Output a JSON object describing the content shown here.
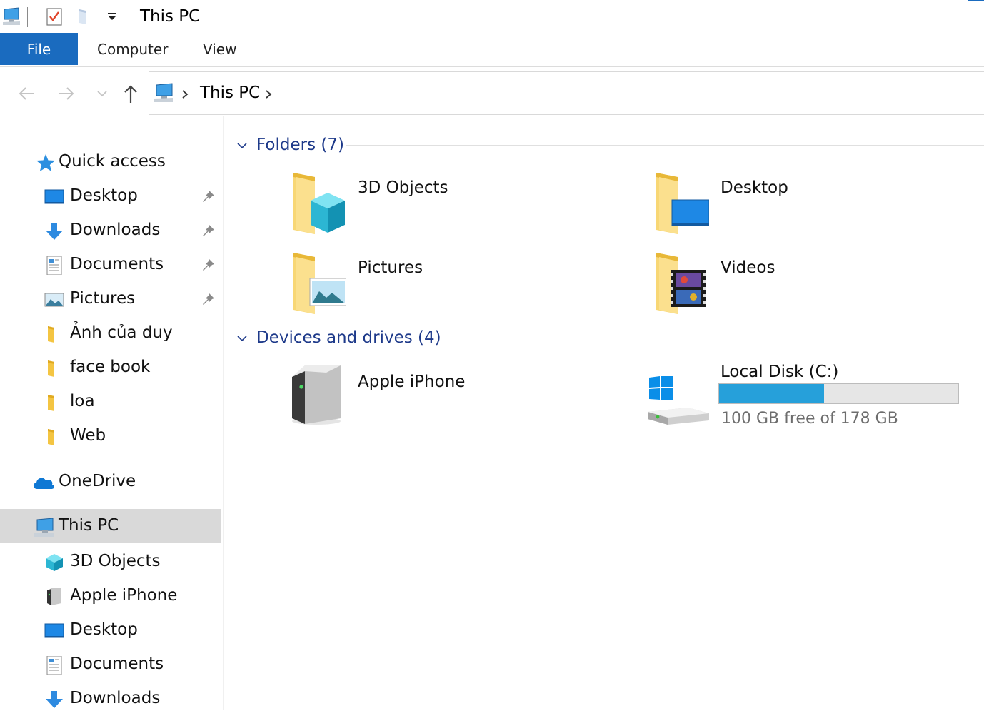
{
  "window": {
    "title": "This PC"
  },
  "ribbon": {
    "tabs": [
      "File",
      "Computer",
      "View"
    ]
  },
  "address": {
    "path": "This PC"
  },
  "sidebar": {
    "quick_access": {
      "label": "Quick access",
      "items": [
        {
          "label": "Desktop",
          "icon": "desktop-icon",
          "pinned": true
        },
        {
          "label": "Downloads",
          "icon": "downloads-icon",
          "pinned": true
        },
        {
          "label": "Documents",
          "icon": "documents-icon",
          "pinned": true
        },
        {
          "label": "Pictures",
          "icon": "pictures-icon",
          "pinned": true
        },
        {
          "label": "Ảnh của duy",
          "icon": "folder-icon",
          "pinned": false
        },
        {
          "label": "face book",
          "icon": "folder-icon",
          "pinned": false
        },
        {
          "label": "loa",
          "icon": "folder-icon",
          "pinned": false
        },
        {
          "label": "Web",
          "icon": "folder-icon",
          "pinned": false
        }
      ]
    },
    "onedrive": {
      "label": "OneDrive"
    },
    "this_pc": {
      "label": "This PC",
      "items": [
        {
          "label": "3D Objects",
          "icon": "cube-icon"
        },
        {
          "label": "Apple iPhone",
          "icon": "device-icon"
        },
        {
          "label": "Desktop",
          "icon": "desktop-icon"
        },
        {
          "label": "Documents",
          "icon": "documents-icon"
        },
        {
          "label": "Downloads",
          "icon": "downloads-icon"
        }
      ]
    }
  },
  "content": {
    "folders_header": "Folders (7)",
    "folders": [
      {
        "label": "3D Objects",
        "icon": "folder-3d-objects-icon"
      },
      {
        "label": "Desktop",
        "icon": "folder-desktop-icon"
      },
      {
        "label": "Pictures",
        "icon": "folder-pictures-icon"
      },
      {
        "label": "Videos",
        "icon": "folder-videos-icon"
      }
    ],
    "devices_header": "Devices and drives (4)",
    "devices": [
      {
        "label": "Apple iPhone",
        "icon": "portable-device-icon"
      },
      {
        "label": "Local Disk (C:)",
        "icon": "windows-drive-icon",
        "free_text": "100 GB free of 178 GB",
        "used_fraction": 0.438
      }
    ]
  },
  "colors": {
    "file_tab": "#1a6bbf",
    "selection": "#d9d9d9",
    "group_header": "#1e3a8a",
    "drive_fill": "#26a0da",
    "folder_yellow": "#f8d775"
  }
}
